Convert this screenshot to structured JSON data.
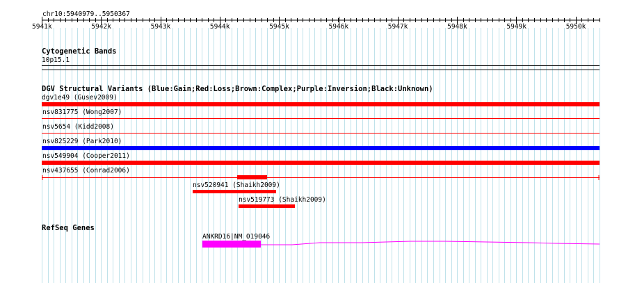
{
  "ruler": {
    "location": "chr10:5940979..5950367",
    "ticks": [
      "5941k",
      "5942k",
      "5943k",
      "5944k",
      "5945k",
      "5946k",
      "5947k",
      "5948k",
      "5949k",
      "5950k"
    ]
  },
  "cytobands": {
    "title": "Cytogenetic Bands",
    "band": "10p15.1"
  },
  "dgv": {
    "title": "DGV Structural Variants (Blue:Gain;Red:Loss;Brown:Complex;Purple:Inversion;Black:Unknown)",
    "variants": [
      {
        "label": "dgv1e49 (Gusev2009)",
        "color": "#ff0000"
      },
      {
        "label": "nsv831775 (Wong2007)",
        "color": "#ff0000"
      },
      {
        "label": "nsv5654 (Kidd2008)",
        "color": "#ff0000"
      },
      {
        "label": "nsv825229 (Park2010)",
        "color": "#0000ff"
      },
      {
        "label": "nsv549904 (Cooper2011)",
        "color": "#ff0000"
      },
      {
        "label": "nsv437655 (Conrad2006)",
        "color": "#ff0000"
      },
      {
        "label": "nsv520941 (Shaikh2009)",
        "color": "#ff0000"
      },
      {
        "label": "nsv519773 (Shaikh2009)",
        "color": "#ff0000"
      }
    ]
  },
  "refseq": {
    "title": "RefSeq Genes",
    "gene": "ANKRD16|NM_019046",
    "color": "#ff00ff"
  }
}
